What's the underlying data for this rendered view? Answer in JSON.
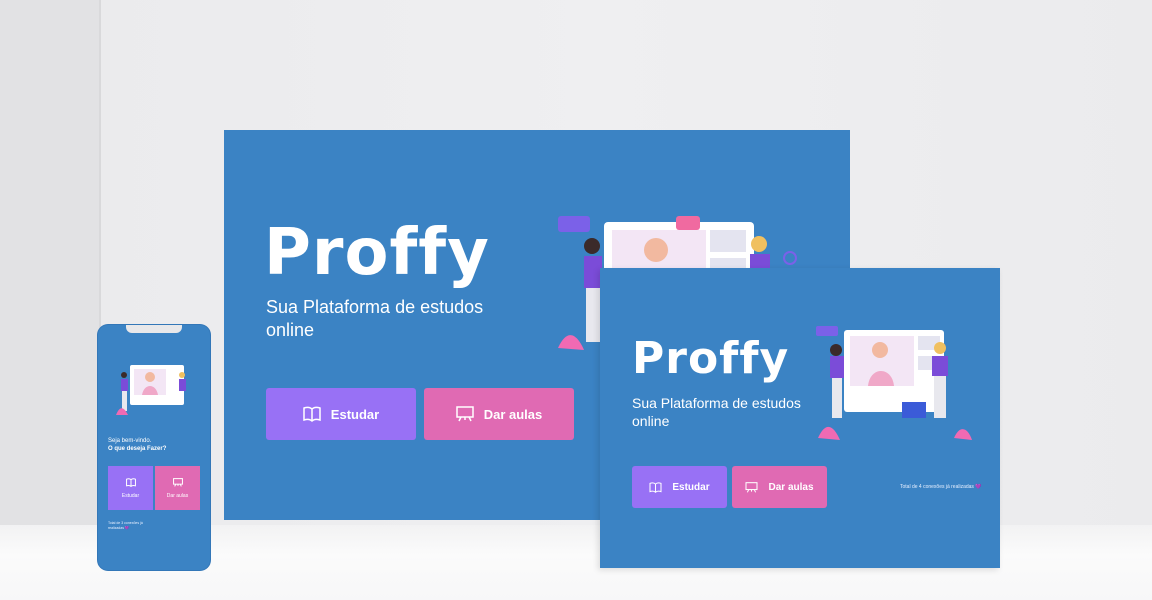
{
  "app": {
    "logo": "Proffy",
    "tagline": "Sua Plataforma de estudos online",
    "buttons": {
      "study": "Estudar",
      "teach": "Dar aulas"
    }
  },
  "desktop": {
    "total": "Total de 4 conexões já realizadas 💜"
  },
  "mobile": {
    "greeting": "Seja bem-vindo.",
    "question": "O que deseja Fazer?",
    "study": "Estudar",
    "teach": "Dar aulas",
    "total": "Total de 3 conexões já realizadas 💜"
  },
  "colors": {
    "background": "#3b83c4",
    "study_button": "#9871f5",
    "teach_button": "#e06ab3",
    "text": "#ffffff"
  },
  "icons": {
    "study": "book-open-icon",
    "teach": "presentation-board-icon"
  }
}
